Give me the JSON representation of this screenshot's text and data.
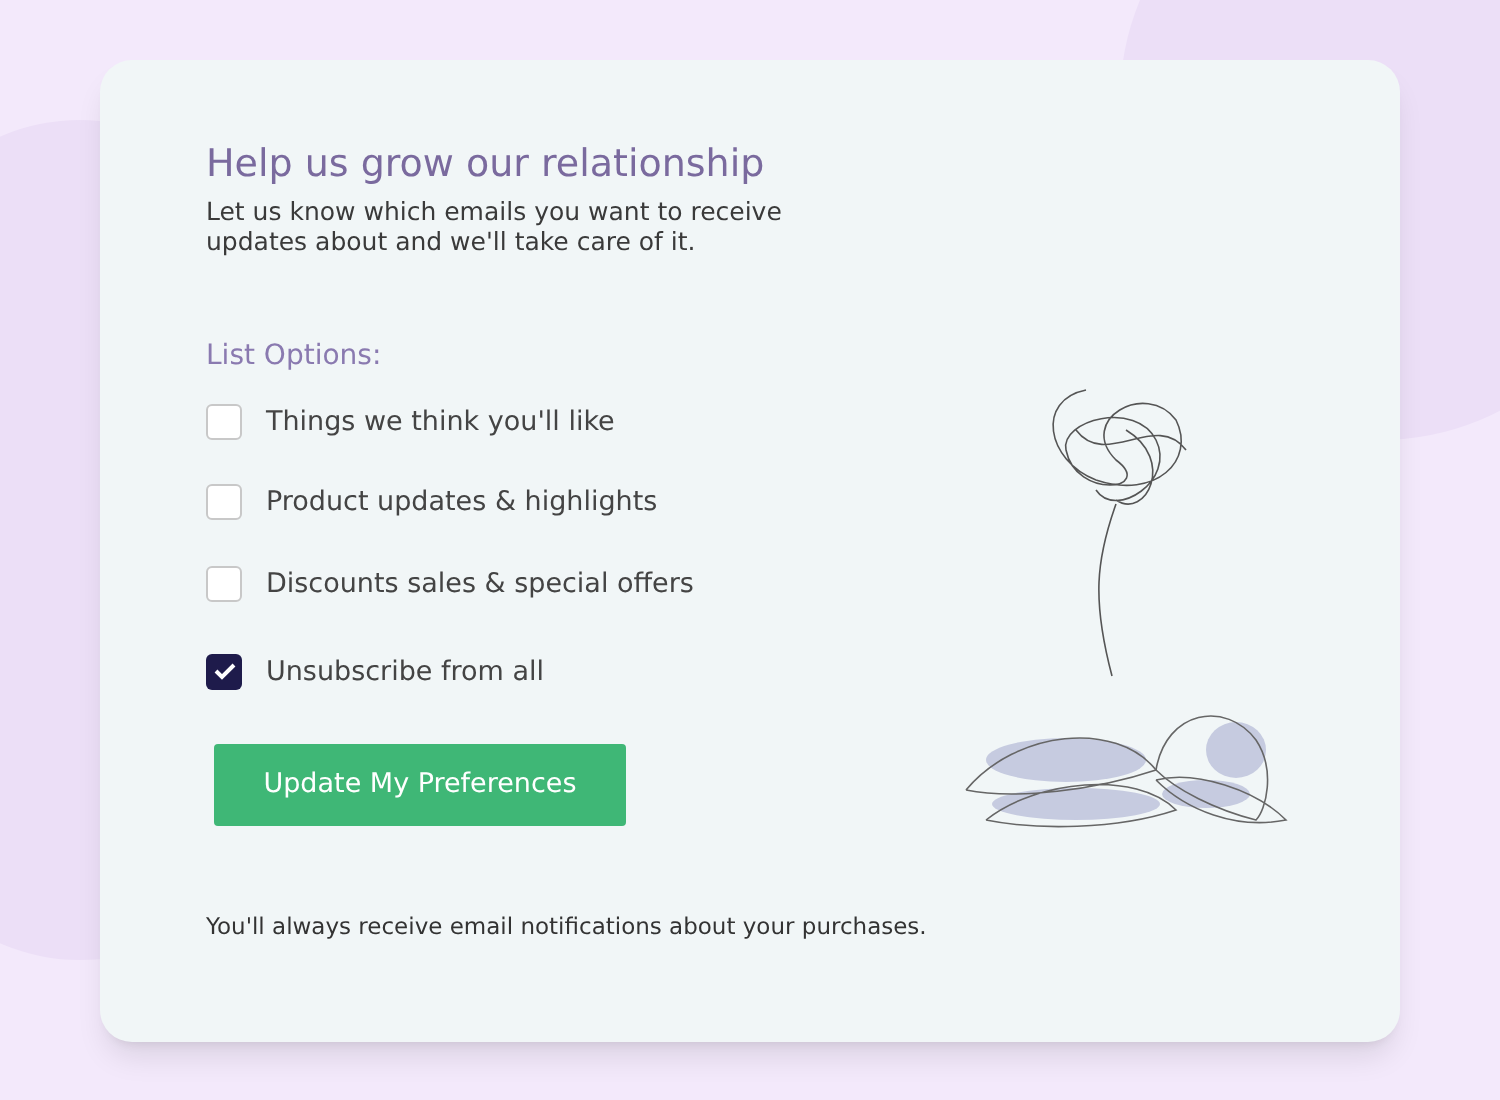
{
  "card": {
    "title": "Help us grow our relationship",
    "subtitle": "Let us know which emails you want to receive updates about and we'll take care of it.",
    "list_heading": "List Options:",
    "options": [
      {
        "label": "Things we think you'll like",
        "checked": false
      },
      {
        "label": "Product updates & highlights",
        "checked": false
      },
      {
        "label": "Discounts sales & special offers",
        "checked": false
      },
      {
        "label": "Unsubscribe from all",
        "checked": true
      }
    ],
    "button": "Update My Preferences",
    "footnote": "You'll always receive email notifications about your purchases."
  }
}
